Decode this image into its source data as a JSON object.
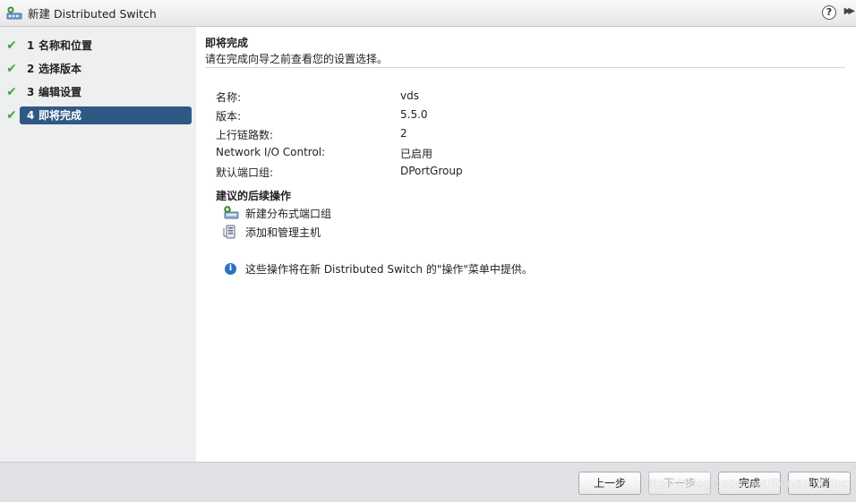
{
  "window": {
    "title": "新建 Distributed Switch",
    "help_glyph": "?",
    "expand_glyph": "▶▶"
  },
  "sidebar": {
    "steps": [
      {
        "num": "1",
        "label": "名称和位置",
        "done": true
      },
      {
        "num": "2",
        "label": "选择版本",
        "done": true
      },
      {
        "num": "3",
        "label": "编辑设置",
        "done": true
      },
      {
        "num": "4",
        "label": "即将完成",
        "done": true,
        "active": true
      }
    ],
    "check_glyph": "✔"
  },
  "main": {
    "title": "即将完成",
    "subtitle": "请在完成向导之前查看您的设置选择。",
    "summary": [
      {
        "key": "名称:",
        "value": "vds"
      },
      {
        "key": "版本:",
        "value": "5.5.0"
      },
      {
        "key": "上行链路数:",
        "value": "2"
      },
      {
        "key": "Network I/O Control:",
        "value": "已启用"
      },
      {
        "key": "默认端口组:",
        "value": "DPortGroup"
      }
    ],
    "next_actions_title": "建议的后续操作",
    "next_actions": [
      {
        "label": "新建分布式端口组",
        "icon": "new-port-group-icon"
      },
      {
        "label": "添加和管理主机",
        "icon": "add-host-icon"
      }
    ],
    "info_glyph": "i",
    "info_text": "这些操作将在新 Distributed Switch 的\"操作\"菜单中提供。"
  },
  "footer": {
    "back_label": "上一步",
    "next_label": "下一步",
    "finish_label": "完成",
    "cancel_label": "取消"
  },
  "watermark": "https://blog.csdn.net/Rondsoft_Inc"
}
